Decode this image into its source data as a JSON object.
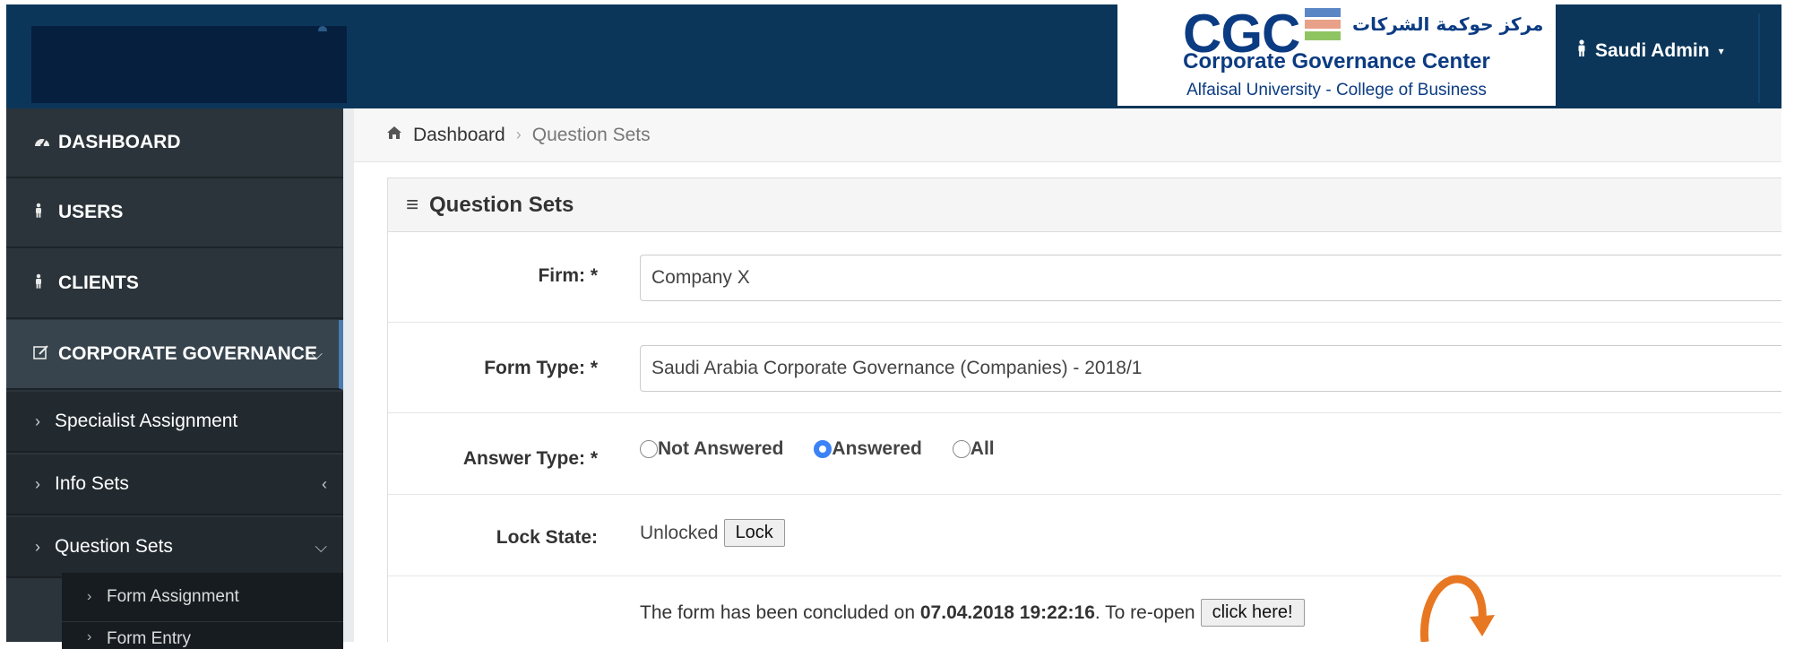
{
  "header": {
    "logo": {
      "mark": "CGC",
      "arabic_name": "مركز حوكمة الشركات",
      "title": "Corporate Governance Center",
      "subtitle": "Alfaisal University -  College of Business",
      "bar_colors": [
        "#5b86c5",
        "#e8a088",
        "#8fc463"
      ]
    },
    "user_menu": {
      "label": "Saudi Admin"
    }
  },
  "sidebar": {
    "items": [
      {
        "label": "DASHBOARD",
        "icon": "dashboard-icon"
      },
      {
        "label": "USERS",
        "icon": "user-icon"
      },
      {
        "label": "CLIENTS",
        "icon": "user-icon"
      },
      {
        "label": "CORPORATE GOVERNANCE",
        "icon": "edit-icon"
      }
    ],
    "sub_items": [
      {
        "label": "Specialist Assignment"
      },
      {
        "label": "Info Sets"
      },
      {
        "label": "Question Sets"
      }
    ],
    "sub_sub_items": [
      {
        "label": "Form Assignment"
      },
      {
        "label": "Form Entry"
      }
    ]
  },
  "breadcrumb": {
    "home": "Dashboard",
    "current": "Question Sets"
  },
  "panel": {
    "title": "Question Sets",
    "firm_label": "Firm: *",
    "firm_value": "Company X",
    "form_type_label": "Form Type: *",
    "form_type_value": "Saudi Arabia Corporate Governance (Companies) - 2018/1",
    "answer_type_label": "Answer Type: *",
    "answer_options": [
      {
        "label": "Not Answered",
        "selected": false
      },
      {
        "label": "Answered",
        "selected": true
      },
      {
        "label": "All",
        "selected": false
      }
    ],
    "lock_state_label": "Lock State:",
    "lock_state_value": "Unlocked",
    "lock_button": "Lock",
    "concluded_prefix": "The form has been concluded on ",
    "concluded_date": "07.04.2018 19:22:16",
    "concluded_suffix": ". To re-open",
    "reopen_button": "click here!"
  },
  "colors": {
    "header_bg": "#0b3659",
    "sidebar_bg": "#2b343a",
    "accent": "#3b82f6",
    "annotation": "#e87722"
  }
}
